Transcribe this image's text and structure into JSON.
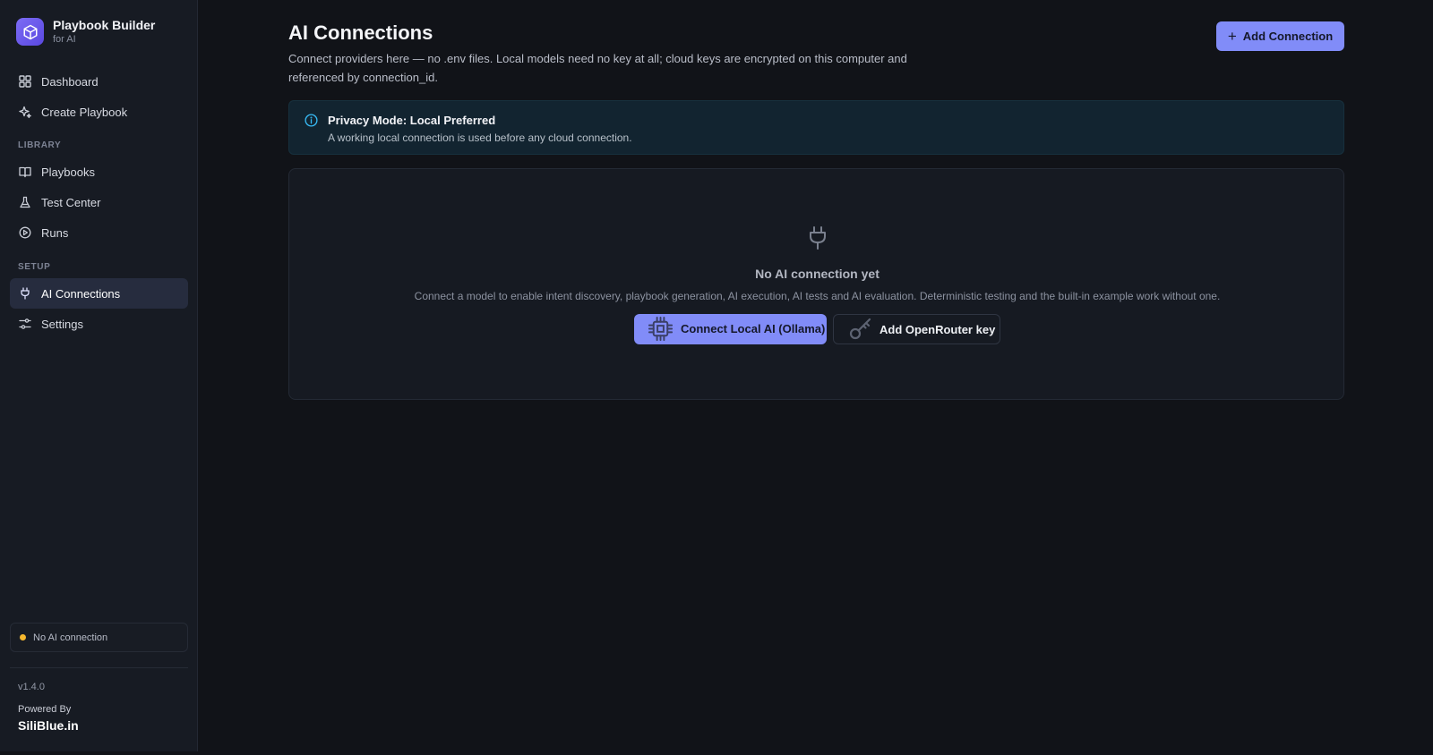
{
  "brand": {
    "title": "Playbook Builder",
    "subtitle": "for AI"
  },
  "sidebar": {
    "items": [
      {
        "label": "Dashboard",
        "icon": "grid-icon"
      },
      {
        "label": "Create Playbook",
        "icon": "sparkle-icon"
      }
    ],
    "library_label": "LIBRARY",
    "library_items": [
      {
        "label": "Playbooks",
        "icon": "book-icon"
      },
      {
        "label": "Test Center",
        "icon": "flask-icon"
      },
      {
        "label": "Runs",
        "icon": "play-circle-icon"
      }
    ],
    "setup_label": "SETUP",
    "setup_items": [
      {
        "label": "AI Connections",
        "icon": "plug-icon",
        "active": true
      },
      {
        "label": "Settings",
        "icon": "sliders-icon"
      }
    ],
    "status": "No AI connection",
    "status_color": "#f5b82e",
    "version": "v1.4.0",
    "powered_by": "Powered By",
    "company": "SiliBlue.in"
  },
  "header": {
    "title": "AI Connections",
    "description": "Connect providers here — no .env files. Local models need no key at all; cloud keys are encrypted on this computer and referenced by connection_id.",
    "add_button": "Add Connection"
  },
  "banner": {
    "title": "Privacy Mode: Local Preferred",
    "text": "A working local connection is used before any cloud connection."
  },
  "empty_state": {
    "title": "No AI connection yet",
    "text": "Connect a model to enable intent discovery, playbook generation, AI execution, AI tests and AI evaluation. Deterministic testing and the built-in example work without one.",
    "local_button": "Connect Local AI (Ollama)",
    "key_button": "Add OpenRouter key"
  },
  "colors": {
    "accent": "#818cf8",
    "background": "#111318",
    "sidebar": "#171b23",
    "info": "#38bdf8"
  }
}
